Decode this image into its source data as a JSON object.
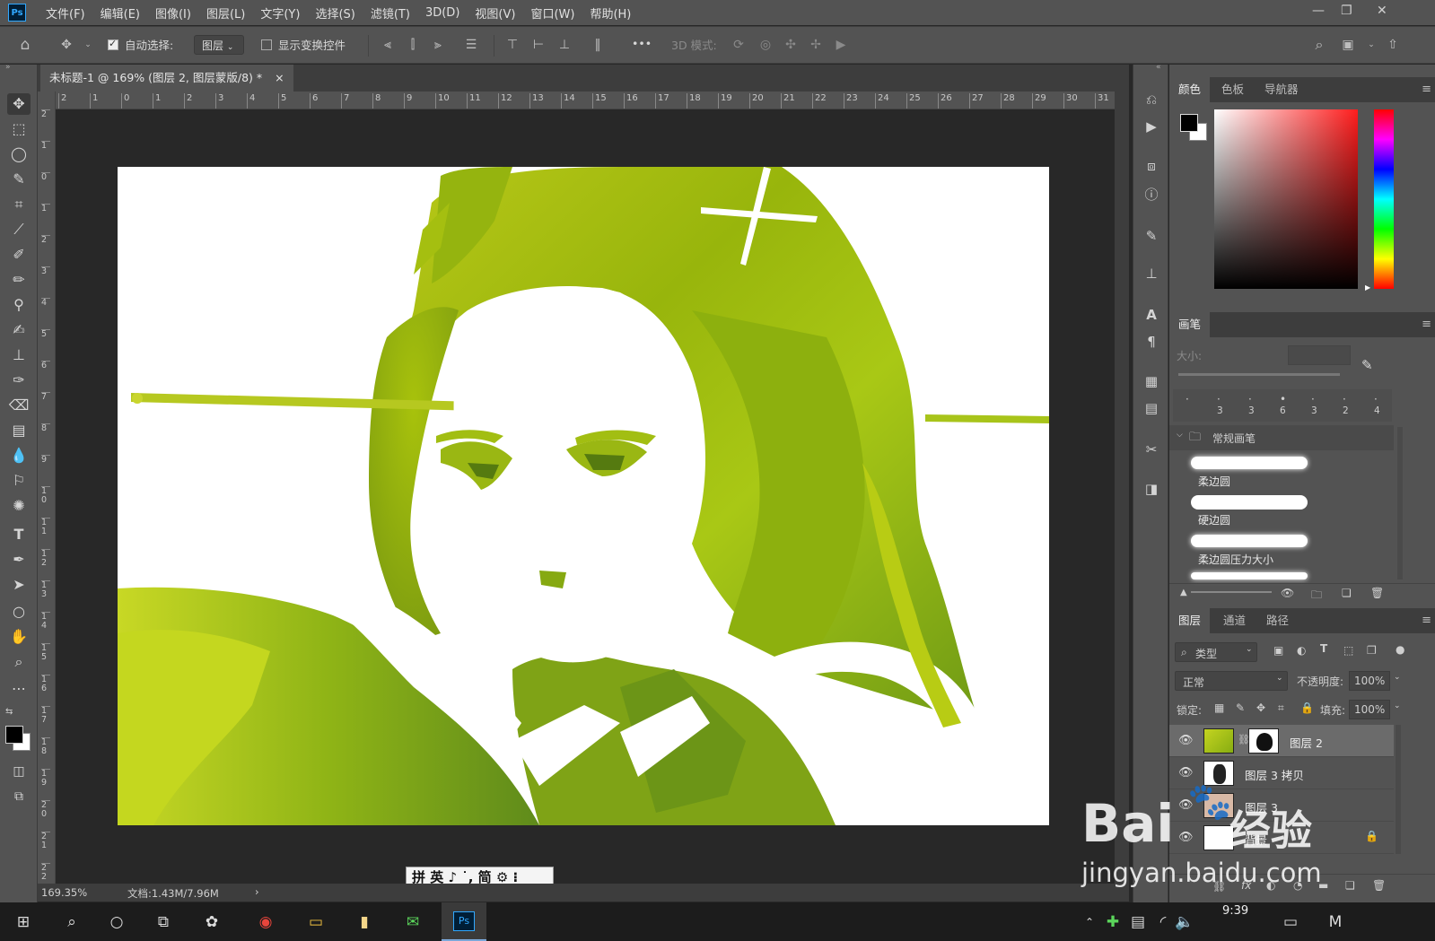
{
  "app": {
    "logo": "Ps"
  },
  "menu": [
    "文件(F)",
    "编辑(E)",
    "图像(I)",
    "图层(L)",
    "文字(Y)",
    "选择(S)",
    "滤镜(T)",
    "3D(D)",
    "视图(V)",
    "窗口(W)",
    "帮助(H)"
  ],
  "options": {
    "auto_select_label": "自动选择:",
    "auto_select_checked": true,
    "auto_select_target": "图层",
    "show_transform_label": "显示变换控件",
    "show_transform_checked": false,
    "mode3d_label": "3D 模式:",
    "more": "•••"
  },
  "document": {
    "tab_title": "未标题-1 @ 169% (图层 2, 图层蒙版/8) *",
    "tab_close": "×",
    "zoom": "169.35%",
    "doc_size": "文档:1.43M/7.96M",
    "status_arrow": "›"
  },
  "rulers": {
    "horizontal": [
      "2",
      "1",
      "0",
      "1",
      "2",
      "3",
      "4",
      "5",
      "6",
      "7",
      "8",
      "9",
      "10",
      "11",
      "12",
      "13",
      "14",
      "15",
      "16",
      "17",
      "18",
      "19",
      "20",
      "21",
      "22",
      "23",
      "24",
      "25",
      "26",
      "27",
      "28",
      "29",
      "30",
      "31"
    ],
    "vertical": [
      "2",
      "1",
      "0",
      "1",
      "2",
      "3",
      "4",
      "5",
      "6",
      "7",
      "8",
      "9",
      "1 0",
      "1 1",
      "1 2",
      "1 3",
      "1 4",
      "1 5",
      "1 6",
      "1 7",
      "1 8",
      "1 9",
      "2 0",
      "2 1",
      "2 2"
    ]
  },
  "ime": {
    "text": "拼 英 ♪ ˙, 简 ⚙ ⁝"
  },
  "color_panel": {
    "tabs": [
      "颜色",
      "色板",
      "导航器"
    ],
    "foreground": "#000000",
    "background": "#ffffff",
    "hue_base": "#ff1d1d"
  },
  "brush_panel": {
    "title": "画笔",
    "size_label": "大小:",
    "recent_sizes": [
      "",
      "3",
      "3",
      "6",
      "3",
      "2",
      "4"
    ],
    "folder": "常规画笔",
    "brushes": [
      "柔边圆",
      "硬边圆",
      "柔边圆压力大小"
    ]
  },
  "layers_panel": {
    "tabs": [
      "图层",
      "通道",
      "路径"
    ],
    "filter_kind": "类型",
    "blend_mode": "正常",
    "opacity_label": "不透明度:",
    "opacity": "100%",
    "lock_label": "锁定:",
    "fill_label": "填充:",
    "fill": "100%",
    "layers": [
      {
        "name": "图层 2",
        "selected": true
      },
      {
        "name": "图层 3 拷贝",
        "selected": false
      },
      {
        "name": "图层 3",
        "selected": false
      },
      {
        "name": "背景",
        "selected": false
      }
    ],
    "footer": [
      "⛓",
      "fx",
      "◐",
      "◔",
      "▬",
      "❏",
      "🗑"
    ]
  },
  "taskbar": {
    "time": "9:39"
  },
  "watermark": {
    "brand": "Bai",
    "brand_cn": "经验",
    "url": "jingyan.baidu.com"
  }
}
